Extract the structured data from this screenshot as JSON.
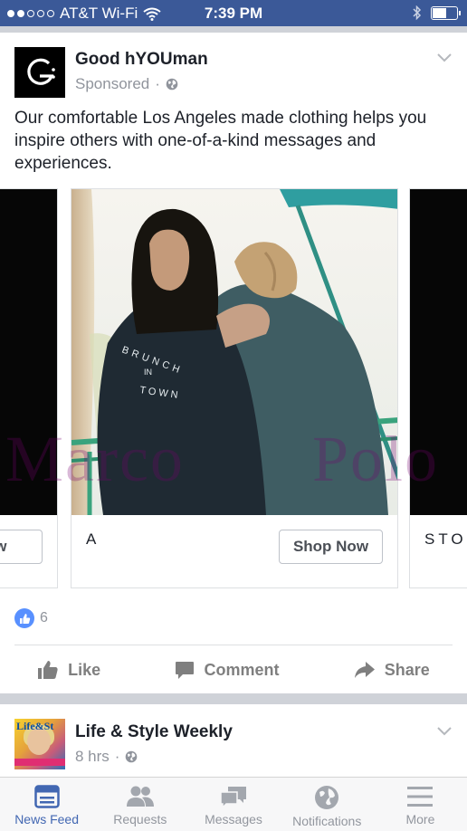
{
  "status_bar": {
    "carrier": "AT&T Wi-Fi",
    "time": "7:39 PM",
    "signal_dots_filled": 2,
    "signal_dots_total": 5,
    "battery_level": 0.55
  },
  "post": {
    "page_name": "Good hYOUman",
    "avatar_letter": "G:",
    "sponsored": "Sponsored",
    "meta_separator": "·",
    "text": "Our comfortable Los Angeles made clothing helps you inspire others with one-of-a-kind messages and experiences.",
    "cards": [
      {
        "label": "",
        "button": "Now"
      },
      {
        "label": "A",
        "button": "Shop Now",
        "shirt_text_1": "BRUNCH",
        "shirt_text_2": "IN",
        "shirt_text_3": "TOWN"
      },
      {
        "label": "STO",
        "button": ""
      }
    ],
    "watermark": {
      "left": "Marco",
      "right": "Polo"
    },
    "like_count": "6",
    "actions": {
      "like": "Like",
      "comment": "Comment",
      "share": "Share"
    }
  },
  "next_post": {
    "page_name": "Life & Style Weekly",
    "time": "8 hrs",
    "separator": "·",
    "magazine_title": "Life&St"
  },
  "tabbar": {
    "tabs": [
      {
        "label": "News Feed",
        "icon": "news-feed-icon",
        "active": true
      },
      {
        "label": "Requests",
        "icon": "requests-icon"
      },
      {
        "label": "Messages",
        "icon": "messages-icon"
      },
      {
        "label": "Notifications",
        "icon": "notifications-icon"
      },
      {
        "label": "More",
        "icon": "more-icon"
      }
    ]
  },
  "colors": {
    "brand": "#3b5998",
    "active_tab": "#4267b2",
    "like_badge": "#5890ff"
  }
}
